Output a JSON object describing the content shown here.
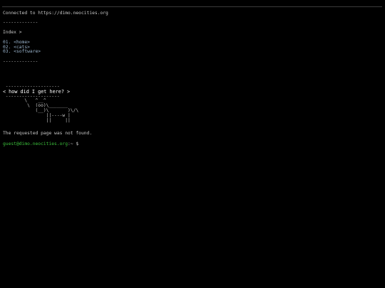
{
  "terminal": {
    "connected_text": "Connected to https://dimo.neocities.org",
    "separator_top": "-------------",
    "index_label": "Index >",
    "nav_items": [
      {
        "number": "01.",
        "label": "<home>"
      },
      {
        "number": "02.",
        "label": "<cats>"
      },
      {
        "number": "03.",
        "label": "<software>"
      }
    ],
    "separator_bottom": "-------------",
    "cowsay": {
      "bubble_top": " --------------------",
      "message": "< how did I get here? >",
      "bubble_bottom": " --------------------",
      "cow_lines": [
        "        \\   ^__^",
        "         \\  (oo)\\_______",
        "            (__)\\       )\\/\\",
        "                ||----w |",
        "                ||     ||"
      ]
    },
    "not_found_text": "The requested page was not found.",
    "prompt_user": "guest@dimo.neocities.org",
    "prompt_suffix": ":~ $"
  },
  "colors": {
    "background": "#000000",
    "text": "#c8c8c8",
    "link": "#9ab4cc",
    "prompt": "#3bbf3b"
  }
}
